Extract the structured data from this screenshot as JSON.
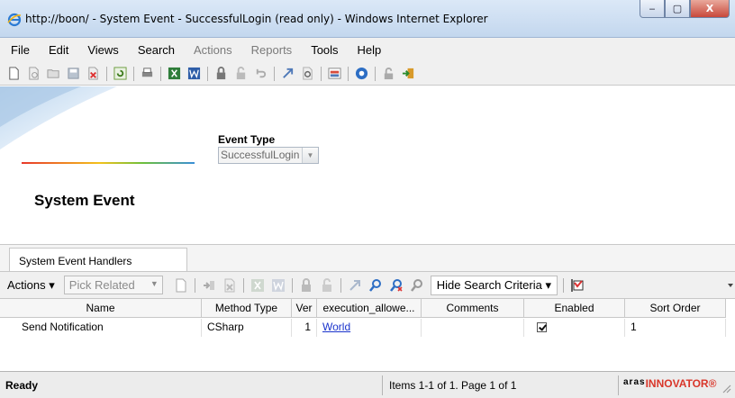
{
  "window": {
    "title": "http://boon/ - System Event - SuccessfulLogin (read only) - Windows Internet Explorer",
    "controls": {
      "minimize": "‒",
      "maximize": "▢",
      "close": "X"
    }
  },
  "menu": {
    "items": [
      {
        "label": "File",
        "enabled": true
      },
      {
        "label": "Edit",
        "enabled": true
      },
      {
        "label": "Views",
        "enabled": true
      },
      {
        "label": "Search",
        "enabled": true
      },
      {
        "label": "Actions",
        "enabled": false
      },
      {
        "label": "Reports",
        "enabled": false
      },
      {
        "label": "Tools",
        "enabled": true
      },
      {
        "label": "Help",
        "enabled": true
      }
    ]
  },
  "toolbar": {
    "icons": [
      "new-icon",
      "view-icon",
      "open-icon",
      "save-icon",
      "delete-icon",
      "refresh-icon",
      "print-icon",
      "excel-icon",
      "word-icon",
      "lock-icon",
      "unlock-icon",
      "undo-icon",
      "promote-icon",
      "where-used-icon",
      "structure-icon",
      "help-icon",
      "discard-icon",
      "exit-icon"
    ]
  },
  "form": {
    "event_type_label": "Event Type",
    "event_type_value": "SuccessfulLogin",
    "title": "System Event"
  },
  "relationships": {
    "tab_label": "System Event Handlers",
    "actions_label": "Actions ▾",
    "pick_related_label": "Pick Related",
    "search_mode_label": "Hide Search Criteria ▾"
  },
  "grid": {
    "columns": [
      "Name",
      "Method Type",
      "Ver",
      "execution_allowe...",
      "Comments",
      "Enabled",
      "Sort Order"
    ],
    "rows": [
      {
        "name": "Send Notification",
        "method_type": "CSharp",
        "ver": "1",
        "execution_allowed": "World",
        "comments": "",
        "enabled": true,
        "sort_order": "1"
      }
    ]
  },
  "status": {
    "text": "Ready",
    "items_text": "Items 1-1 of 1. Page 1 of 1",
    "logo_small": "aras",
    "logo_main": "INNOVATOR",
    "logo_tm": "®"
  },
  "colors": {
    "brand_red": "#d9362a",
    "link_blue": "#1a33cc",
    "titlebar": "#c3d7ee"
  }
}
